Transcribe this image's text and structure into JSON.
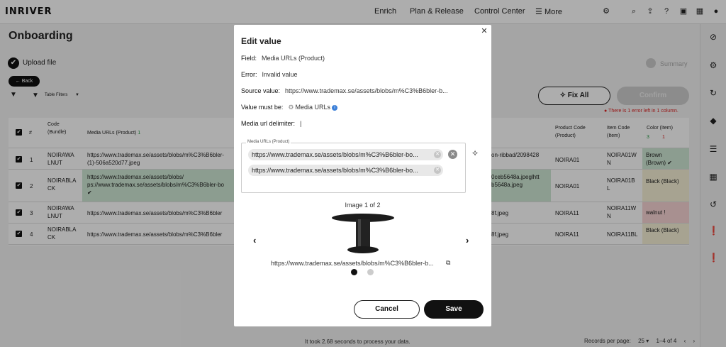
{
  "header": {
    "logo": "INRIVER",
    "nav": [
      "Enrich",
      "Plan & Release",
      "Control Center",
      "More"
    ],
    "more_icon": "menu-icon",
    "icons": [
      "tools-icon",
      "search-icon",
      "upload-icon",
      "help-icon",
      "language-icon",
      "calendar-icon",
      "user-icon"
    ]
  },
  "page": {
    "title": "Onboarding",
    "upload_step": "Upload file",
    "back_label": "Back",
    "table_filters": "Table Filters",
    "summary_step": "Summary",
    "fix_all": "Fix All",
    "confirm": "Confirm",
    "error_note": "There is 1 error left in 1 column.",
    "footer_note": "It took 2.68 seconds to process your data.",
    "records_per_page_label": "Records per page:",
    "records_per_page": "25",
    "range": "1–4 of 4"
  },
  "table": {
    "headers": {
      "num": "#",
      "code": "Code (Bundle)",
      "media": "Media URLs (Product)",
      "media_count": "1",
      "product_code": "Product Code (Product)",
      "item_code": "Item Code (Item)",
      "color": "Color (Item)",
      "color_ok": "3",
      "color_err": "1"
    },
    "rows": [
      {
        "n": "1",
        "code": "NOIRAWA LNUT",
        "media": "https://www.trademax.se/assets/blobs/m%C3%B6bler-",
        "media2": "(1)-506a520d77.jpeg",
        "right_media": "on-ribbad/2098428",
        "right_media2": "",
        "product": "NOIRA01",
        "item": "NOIRA01W N",
        "color": "Brown (Brown) ✔"
      },
      {
        "n": "2",
        "code": "NOIRABLA CK",
        "media": "https://www.trademax.se/assets/blobs/",
        "media2": "ps://www.trademax.se/assets/blobs/m%C3%B6bler-bo",
        "right_media": "0ceb5648a.jpeglhtt",
        "right_media2": "b5648a.jpeg",
        "product": "NOIRA01",
        "item": "NOIRA01B L",
        "color": "Black (Black)"
      },
      {
        "n": "3",
        "code": "NOIRAWA LNUT",
        "media": "https://www.trademax.se/assets/blobs/m%C3%B6bler",
        "media2": "",
        "right_media": "8f.jpeg",
        "right_media2": "",
        "product": "NOIRA11",
        "item": "NOIRA11W N",
        "color": "walnut !"
      },
      {
        "n": "4",
        "code": "NOIRABLA CK",
        "media": "https://www.trademax.se/assets/blobs/m%C3%B6bler",
        "media2": "",
        "right_media": "8f.jpeg",
        "right_media2": "",
        "product": "NOIRA11",
        "item": "NOIRA11BL",
        "color": "Black (Black)"
      }
    ]
  },
  "modal": {
    "title": "Edit value",
    "field_label": "Field:",
    "field_value": "Media URLs (Product)",
    "error_label": "Error:",
    "error_value": "Invalid value",
    "source_label": "Source value:",
    "source_value": "https://www.trademax.se/assets/blobs/m%C3%B6bler-b...",
    "must_be_label": "Value must be:",
    "must_be_value": "Media URLs",
    "delimiter_label": "Media url delimiter:",
    "delimiter_value": "|",
    "legend": "Media URLs (Product)",
    "chips": [
      "https://www.trademax.se/assets/blobs/m%C3%B6bler-bo...",
      "https://www.trademax.se/assets/blobs/m%C3%B6bler-bo..."
    ],
    "image_count": "Image 1 of 2",
    "image_url": "https://www.trademax.se/assets/blobs/m%C3%B6bler-b...",
    "cancel": "Cancel",
    "save": "Save"
  }
}
